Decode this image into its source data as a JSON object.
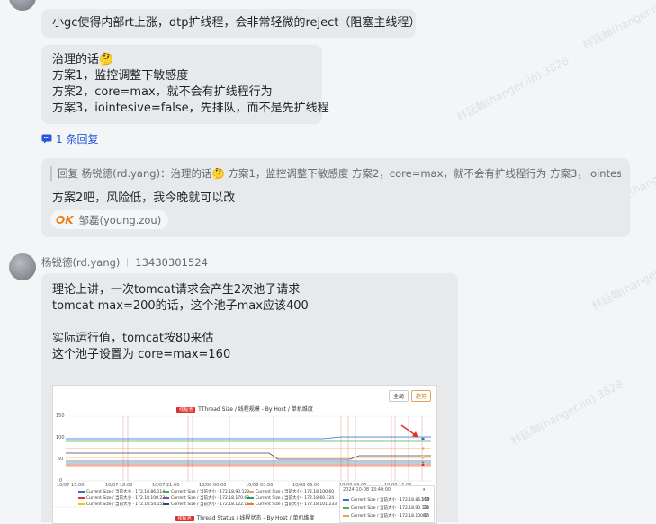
{
  "messages": [
    {
      "lines": [
        "小gc使得内部rt上涨，dtp扩线程，会非常轻微的reject（阻塞主线程）"
      ]
    },
    {
      "lines": [
        "治理的话🤔",
        "方案1，监控调整下敏感度",
        "方案2，core=max，就不会有扩线程行为",
        "方案3，iointesive=false，先排队，而不是先扩线程"
      ]
    }
  ],
  "thread": {
    "label": "1 条回复"
  },
  "reply": {
    "quote": "回复 杨锐德(rd.yang)：治理的话🤔 方案1，监控调整下敏感度 方案2，core=max，就不会有扩线程行为 方案3，iointesive=false...",
    "text": "方案2吧，风险低，我今晚就可以改",
    "reaction": {
      "emoji": "OK",
      "user": "邹磊(young.zou)"
    }
  },
  "sender": {
    "name": "杨锐德(rd.yang)",
    "phone": "13430301524"
  },
  "message2": {
    "lines": [
      "理论上讲，一次tomcat请求会产生2次池子请求",
      "tomcat-max=200的话，这个池子max应该400",
      "",
      "实际运行值，tomcat按80来估",
      "这个池子设置为 core=max=160"
    ]
  },
  "watermark": "林廷翰(hanger.lin) 3828",
  "screenshot": {
    "buttons": [
      "全局",
      "趋势"
    ],
    "panel1": {
      "tag": "线程池",
      "title": "TThread Size / 线程规模 - By Host / 单机维度"
    },
    "panel2": {
      "tag": "线程池",
      "title": "Thread Status / 线程状态 - By Host / 单机维度"
    },
    "y_ticks": [
      "150",
      "100",
      "50",
      "0"
    ],
    "x_ticks": [
      "10/07 15:00",
      "10/07 18:00",
      "10/07 21:00",
      "10/08 00:00",
      "10/08 03:00",
      "10/08 06:00",
      "10/08 09:00",
      "10/08 12:00"
    ],
    "legend": [
      {
        "label": "Current Size / 当前大小 · 172.18.86.114",
        "color": "#2f6fd6"
      },
      {
        "label": "Current Size / 当前大小 · 172.18.90.123",
        "color": "#4caf50"
      },
      {
        "label": "Current Size / 当前大小 · 172.18.100.60",
        "color": "#e3a35a"
      },
      {
        "label": "Current Size / 当前大小 · 172.18.100.224",
        "color": "#e0302a"
      },
      {
        "label": "Current Size / 当前大小 · 172.18.170.60",
        "color": "#8e44ad"
      },
      {
        "label": "Current Size / 当前大小 · 172.18.60.124",
        "color": "#16a085"
      },
      {
        "label": "Current Size / 当前大小 · 172.18.54.155",
        "color": "#f1c40f"
      },
      {
        "label": "Current Size / 当前大小 · 172.18.122.157",
        "color": "#34495e"
      },
      {
        "label": "Current Size / 当前大小 · 172.18.101.233",
        "color": "#e67e22"
      }
    ],
    "tooltip": {
      "time": "2024-10-08 13:40:00",
      "rows": [
        {
          "label": "Current Size / 当前大小 · 172.18.86.114",
          "value": "160"
        },
        {
          "label": "Current Size / 当前大小 · 172.18.90.123",
          "value": "78"
        },
        {
          "label": "Current Size / 当前大小 · 172.18.100.60",
          "value": "62"
        }
      ]
    }
  }
}
